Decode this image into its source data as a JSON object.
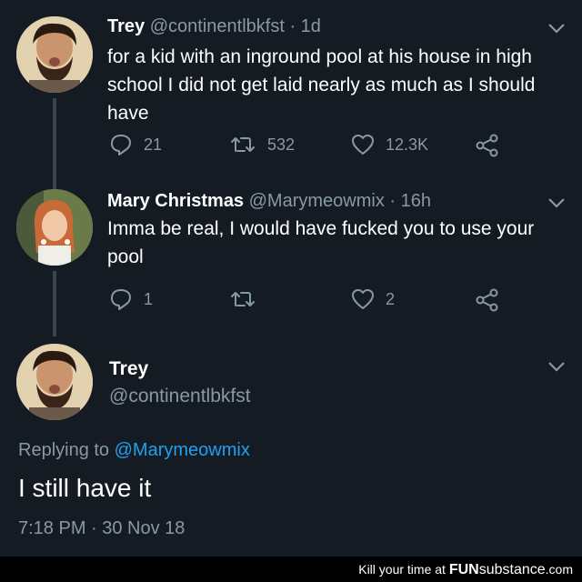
{
  "tweet1": {
    "name": "Trey",
    "handle": "@continentlbkfst",
    "time": "· 1d",
    "text": "for a kid with an inground pool at his house in high school I did not get laid nearly as much as I should have",
    "replies": "21",
    "retweets": "532",
    "likes": "12.3K"
  },
  "tweet2": {
    "name": "Mary Christmas",
    "handle": "@Marymeowmix",
    "time": "· 16h",
    "text": "Imma be real, I would have fucked you to use your pool",
    "replies": "1",
    "retweets": "",
    "likes": "2"
  },
  "tweet3": {
    "name": "Trey",
    "handle": "@continentlbkfst",
    "replying_prefix": "Replying to",
    "replying_to": "@Marymeowmix",
    "text": "I still have it",
    "timestamp": "7:18 PM · 30 Nov 18"
  },
  "watermark": {
    "text": "Kill your time at",
    "brand_a": "FUN",
    "brand_b": "substance",
    "brand_c": ".com"
  },
  "colors": {
    "background": "#151b23",
    "secondary_text": "#8899a6",
    "link": "#1da1f2"
  }
}
